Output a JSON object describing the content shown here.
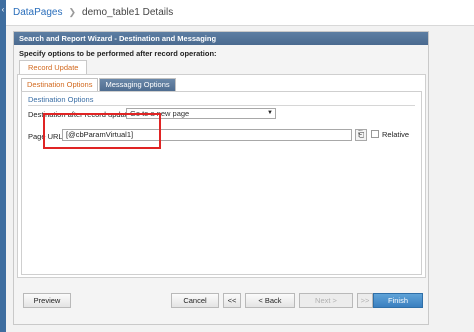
{
  "breadcrumb": {
    "root": "DataPages",
    "current": "demo_table1 Details"
  },
  "wizard": {
    "title": "Search and Report Wizard - Destination and Messaging",
    "description": "Specify options to be performed after record operation:",
    "outer_tab": "Record Update",
    "inner_tabs": [
      "Destination Options",
      "Messaging Options"
    ],
    "section_title": "Destination Options",
    "destination_label": "Destination after record update:",
    "destination_value": "Go to a new page",
    "page_url_label": "Page URL:",
    "page_url_value": "[@cbParamVirtual1]",
    "relative_label": "Relative",
    "relative_checked": false
  },
  "footer": {
    "preview": "Preview",
    "cancel": "Cancel",
    "first": "<<",
    "back": "< Back",
    "next": "Next >",
    "last": ">>",
    "finish": "Finish"
  },
  "colors": {
    "title_bar": "#4a6a8f",
    "link": "#2a6ebb",
    "active_tab_text": "#d2691e",
    "highlight": "#e02424",
    "finish_button": "#3a7fbf"
  },
  "icons": {
    "collapse": "chevron-left-icon",
    "breadcrumb_separator": "chevron-right-icon",
    "select_arrow": "triangle-down-icon",
    "url_picker": "picker-icon"
  }
}
